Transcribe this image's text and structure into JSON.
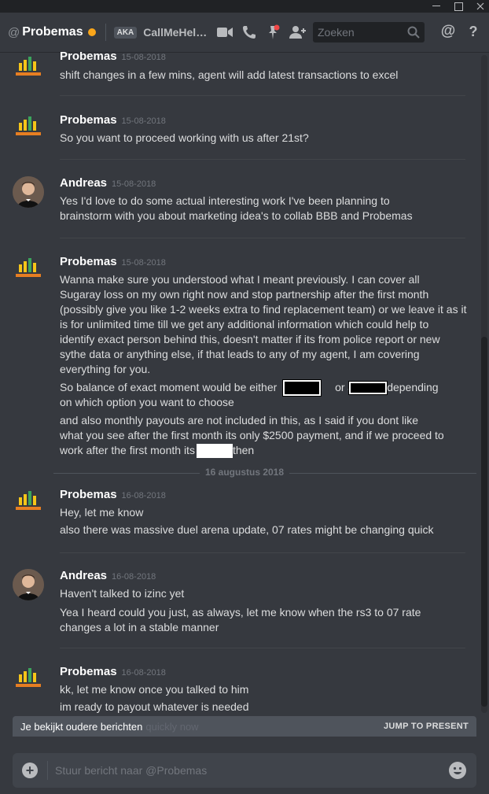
{
  "window": {
    "controls": [
      "minimize",
      "maximize",
      "close"
    ]
  },
  "header": {
    "at_symbol": "@",
    "dm_name": "Probemas",
    "status_color": "#faa61a",
    "aka_badge": "AKA",
    "aka_name": "CallMeHelp...",
    "search_placeholder": "Zoeken",
    "icons": [
      "video-call-icon",
      "voice-call-icon",
      "pinned-messages-icon",
      "add-friend-icon",
      "search-icon",
      "mention-icon",
      "help-icon"
    ],
    "mention_label": "@",
    "help_label": "?"
  },
  "messages": [
    {
      "author": "Probemas",
      "timestamp": "15-08-2018",
      "lines": [
        "shift changes in a few mins, agent will add latest transactions to excel"
      ]
    },
    {
      "author": "Probemas",
      "timestamp": "15-08-2018",
      "lines": [
        "So you want to proceed working with us after 21st?"
      ]
    },
    {
      "author": "Andreas",
      "timestamp": "15-08-2018",
      "lines": [
        "Yes I'd love to do some actual interesting work I've been planning to",
        "brainstorm with you about marketing idea's to collab BBB and Probemas"
      ]
    },
    {
      "author": "Probemas",
      "timestamp": "15-08-2018",
      "lines": [
        "Wanna make sure you understood what I meant previously. I can cover all",
        "Sugaray loss on my own right now and stop partnership after the first month",
        "(possibly give you like 1-2 weeks extra to find replacement team) or we leave it as it",
        "is for unlimited time till we get any additional information which could help to",
        "identify exact person behind this, doesn't matter if its from police report or new",
        "sythe data or anything else, if that leads to  any of my agent, I am covering",
        "everything for you."
      ],
      "balance_a": "So balance of exact moment would be either",
      "balance_b": "or $",
      "balance_c": "depending",
      "balance_line2": "on which option you want to choose",
      "payout_lines": [
        "and also monthly payouts are not included in this, as I said if you dont like",
        "what you see after the first month its only $2500 payment, and if we proceed to"
      ],
      "payout_tail_a": "work after the first month its",
      "payout_tail_b": "then"
    },
    {
      "author": "Probemas",
      "timestamp": "16-08-2018",
      "lines": [
        "Hey, let me know",
        "also there was massive duel arena update, 07 rates might be changing quick"
      ]
    },
    {
      "author": "Andreas",
      "timestamp": "16-08-2018",
      "lines": [
        "Haven't talked to izinc yet",
        "Yea I heard could you just, as always, let me know when the rs3 to 07 rate",
        "changes a lot in a stable manner"
      ]
    },
    {
      "author": "Probemas",
      "timestamp": "16-08-2018",
      "lines": [
        "kk, let me know once you talked to him",
        "im ready to payout whatever is needed"
      ]
    }
  ],
  "date_divider": "16 augustus 2018",
  "older_bar": {
    "text": "Je bekijkt oudere berichten",
    "ghost_text": "quickly now",
    "jump_label": "JUMP TO PRESENT"
  },
  "composer": {
    "placeholder": "Stuur bericht naar @Probemas",
    "value": ""
  },
  "colors": {
    "background": "#36393f",
    "header_bg": "#36393f",
    "composer_bg": "#40444b",
    "older_bar_bg": "#4f545c",
    "status_idle": "#faa61a"
  }
}
